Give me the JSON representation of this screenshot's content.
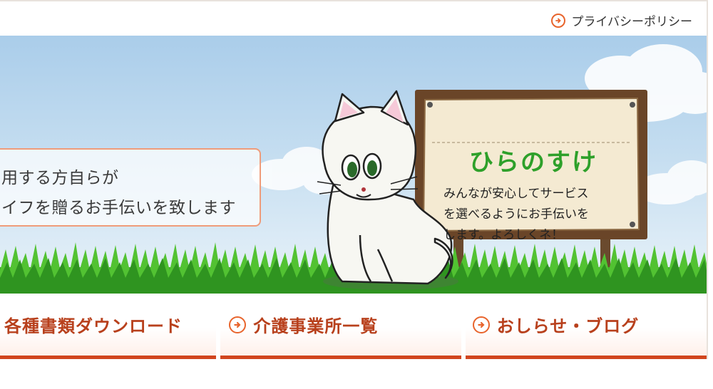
{
  "header": {
    "privacy_link": "プライバシーポリシー"
  },
  "hero": {
    "tagline_lines": [
      "用する方自らが",
      "イフを贈るお手伝いを致します"
    ],
    "sign": {
      "title": "ひらのすけ",
      "body_lines": [
        "みんなが安心してサービス",
        "を選べるようにお手伝いを",
        "します。よろしくネ！"
      ]
    }
  },
  "nav": {
    "items": [
      {
        "label": "各種書類ダウンロード"
      },
      {
        "label": "介護事業所一覧"
      },
      {
        "label": "おしらせ・ブログ"
      }
    ]
  },
  "colors": {
    "accent": "#d1451e",
    "nav_text": "#b8401c",
    "sign_title": "#2ea02a",
    "sky": "#aacdea",
    "grass": "#3fae2a"
  },
  "icons": {
    "link_arrow": "circle-arrow-right-icon"
  }
}
